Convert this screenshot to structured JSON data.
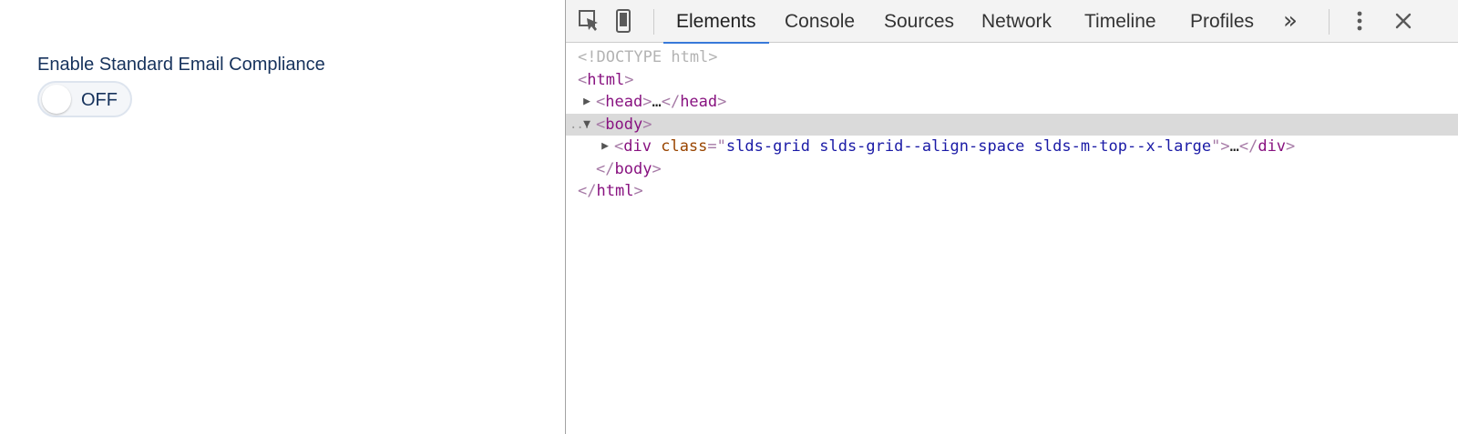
{
  "page": {
    "field_label": "Enable Standard Email Compliance",
    "toggle": {
      "state_label": "OFF",
      "checked": false
    }
  },
  "devtools": {
    "toolbar": {
      "icons": [
        "inspect-element-icon",
        "device-mode-icon",
        "more-tabs-icon",
        "kebab-menu-icon",
        "close-icon"
      ],
      "tabs": [
        {
          "label": "Elements",
          "active": true
        },
        {
          "label": "Console",
          "active": false
        },
        {
          "label": "Sources",
          "active": false
        },
        {
          "label": "Network",
          "active": false
        },
        {
          "label": "Timeline",
          "active": false
        },
        {
          "label": "Profiles",
          "active": false
        }
      ],
      "overflow_glyph": "»"
    },
    "dom": {
      "doctype": "<!DOCTYPE html>",
      "html_tag": "html",
      "head_tag": "head",
      "body_tag": "body",
      "div_tag": "div",
      "div_attr_name": "class",
      "div_attr_value": "slds-grid slds-grid--align-space slds-m-top--x-large",
      "ellipsis": "…",
      "gutter_dots": "...",
      "selected_node": "body"
    },
    "colors": {
      "tag": "#881280",
      "attr_name": "#994500",
      "attr_value": "#1a1aa6",
      "active_tab_underline": "#3879d9",
      "selection": "#dadada"
    }
  }
}
